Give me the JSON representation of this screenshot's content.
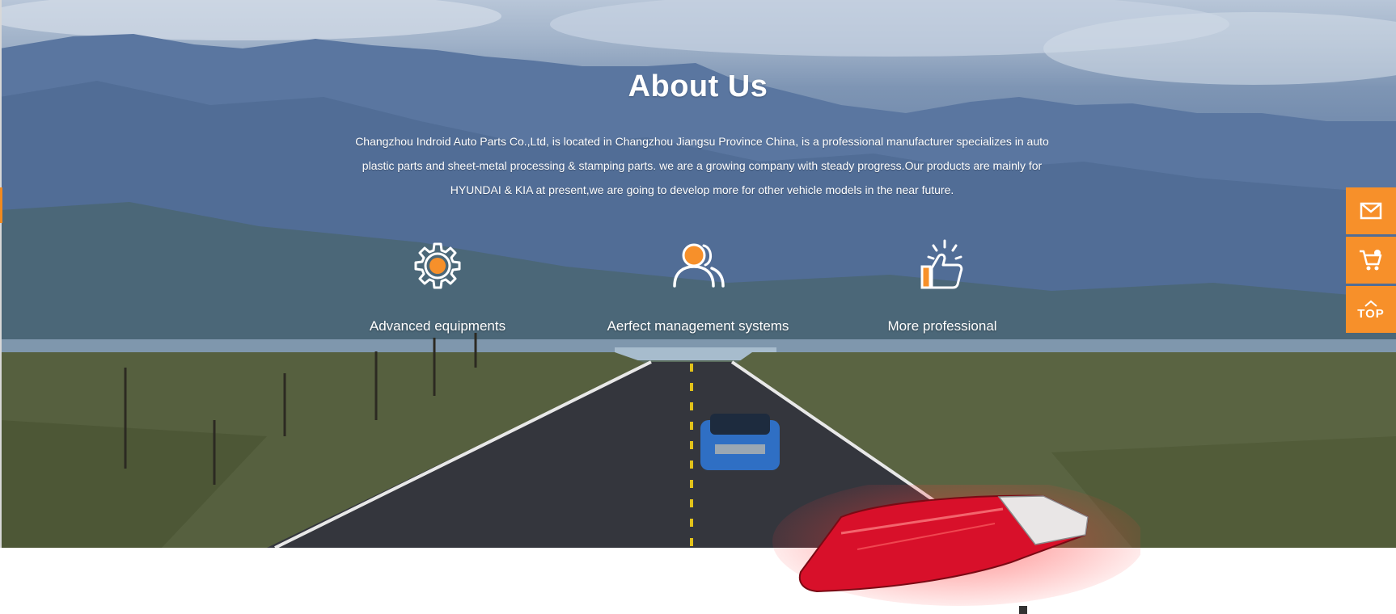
{
  "about": {
    "title": "About Us",
    "lines": [
      "Changzhou Indroid Auto Parts Co.,Ltd, is located in Changzhou Jiangsu Province China, is a professional manufacturer specializes in auto",
      "plastic parts and sheet-metal processing & stamping parts. we are a growing company with steady progress.Our products are mainly for",
      "HYUNDAI & KIA at present,we are going to develop more for other vehicle models in the near future."
    ]
  },
  "features": [
    {
      "label": "Advanced equipments",
      "icon": "gear-icon"
    },
    {
      "label": "Aerfect management systems",
      "icon": "users-icon"
    },
    {
      "label": "More professional",
      "icon": "thumbs-up-icon"
    }
  ],
  "sidebar": {
    "mail_icon": "mail-icon",
    "cart_icon": "cart-icon",
    "top_label": "TOP"
  },
  "colors": {
    "accent": "#f7902a",
    "text": "#ffffff"
  }
}
